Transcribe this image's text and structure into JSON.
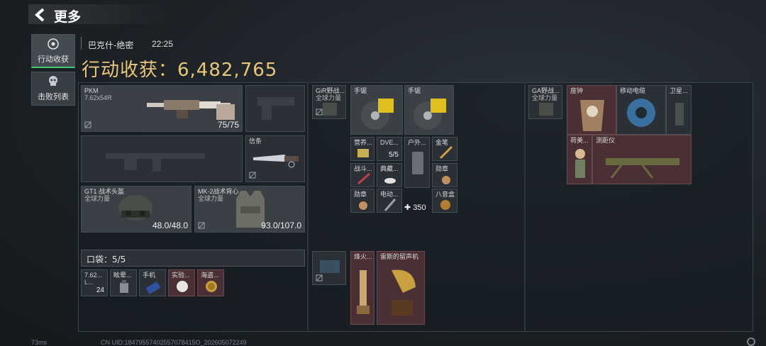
{
  "header": {
    "title": "更多"
  },
  "sidebar": [
    {
      "label": "行动收获",
      "icon": "target-icon",
      "active": true
    },
    {
      "label": "击败列表",
      "icon": "skull-icon",
      "active": false
    }
  ],
  "match": {
    "map": "巴克什-绝密",
    "time": "22:25",
    "harvest_text": "行动收获：6,482,765"
  },
  "loadout": {
    "primary": {
      "name": "PKM",
      "ammo_type": "7.62x54R",
      "value": "75/75"
    },
    "melee": {
      "name": "信条"
    },
    "helmet": {
      "name": "GT1 战术头盔",
      "sub": "全球力量",
      "value": "48.0/48.0"
    },
    "armor": {
      "name": "MK-2战术背心",
      "sub": "全球力量",
      "value": "93.0/107.0"
    },
    "pocket": {
      "label": "口袋：5/5"
    },
    "pocket_items": [
      {
        "name": "7.62...",
        "sub": "L...",
        "count": "24"
      },
      {
        "name": "眩晕...",
        "count": ""
      },
      {
        "name": "手机",
        "count": ""
      },
      {
        "name": "实验...",
        "count": ""
      },
      {
        "name": "海盗...",
        "count": ""
      }
    ]
  },
  "backpack": {
    "rig": {
      "name": "GiR野战...",
      "sub": "全球力量"
    },
    "items": [
      {
        "name": "手锯"
      },
      {
        "name": "手锯"
      },
      {
        "name": "营养..."
      },
      {
        "name": "DVE...",
        "count": "5/5"
      },
      {
        "name": "户外..."
      },
      {
        "name": "金笔"
      },
      {
        "name": "战斗..."
      },
      {
        "name": "典藏..."
      },
      {
        "name": "勋章"
      },
      {
        "name": "勋章"
      },
      {
        "name": "电动..."
      },
      {
        "name": "八音盒"
      },
      {
        "extra": "350"
      }
    ],
    "secure": [
      {
        "name": "烽火..."
      },
      {
        "name": "雷斯的留声机"
      }
    ]
  },
  "backpack2": {
    "rig": {
      "name": "GA野战...",
      "sub": "全球力量"
    },
    "items": [
      {
        "name": "座钟"
      },
      {
        "name": "移动电缆"
      },
      {
        "name": "卫星..."
      },
      {
        "name": "荷美..."
      },
      {
        "name": "测距仪"
      }
    ]
  },
  "footer": {
    "ping": "73ms",
    "uid": "CN UID:18479557402557078415O_202605072249"
  }
}
